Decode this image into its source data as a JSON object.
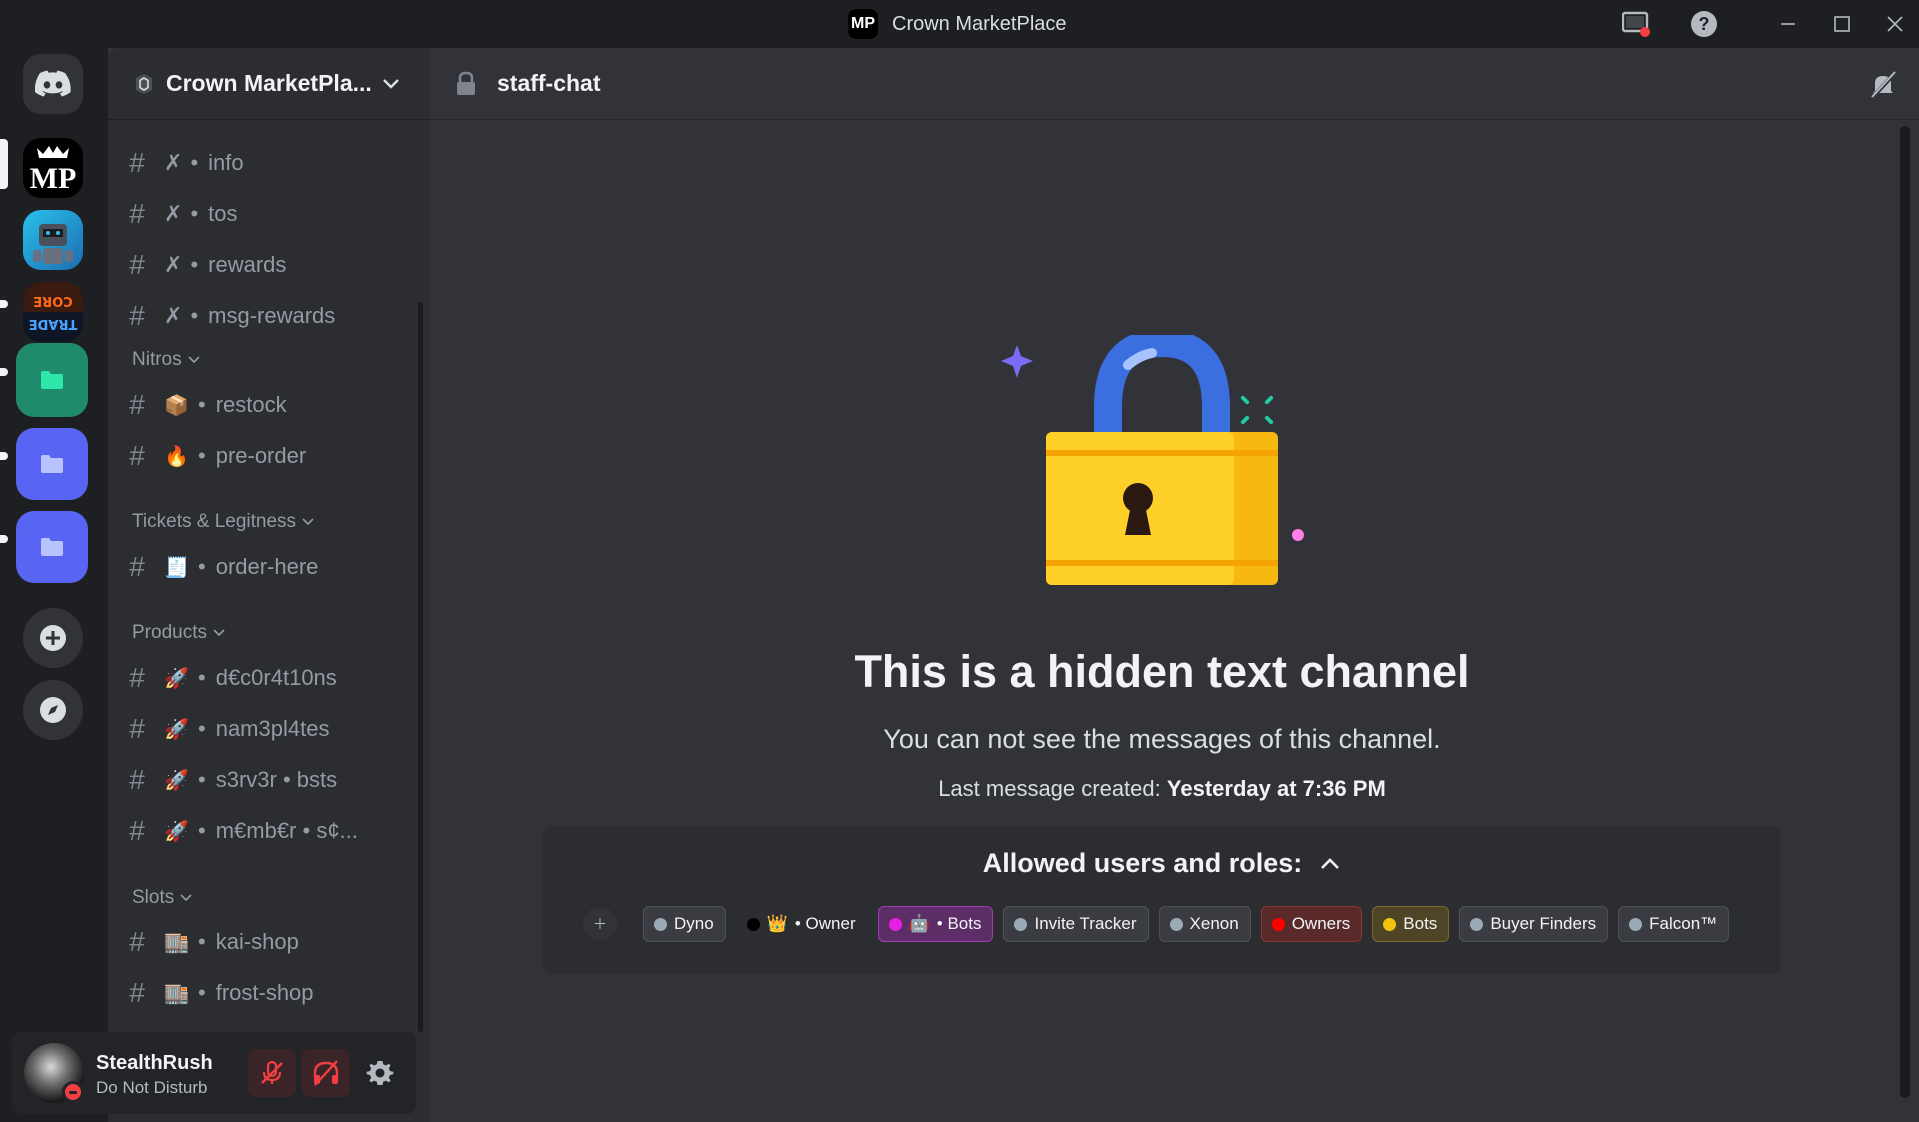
{
  "window": {
    "title": "Crown MarketPlace",
    "logo_text": "MP",
    "icons": [
      "screen-share-icon",
      "help-icon",
      "minimize-icon",
      "maximize-icon",
      "close-icon"
    ]
  },
  "servers": {
    "items": [
      {
        "name": "discord-home",
        "icon": "discord-logo-icon"
      },
      {
        "name": "crown-marketplace",
        "label": "MP"
      },
      {
        "name": "server-robot"
      },
      {
        "name": "server-trade-core"
      },
      {
        "name": "folder-green",
        "color": "#1f8b6c"
      },
      {
        "name": "folder-blue-1",
        "color": "#5865f2"
      },
      {
        "name": "folder-blue-2",
        "color": "#5865f2"
      },
      {
        "name": "add-server",
        "icon": "plus-icon"
      },
      {
        "name": "explore",
        "icon": "compass-icon"
      }
    ]
  },
  "sidebar": {
    "server_name": "Crown MarketPla...",
    "channels_top": [
      {
        "prefix": "✗",
        "label": "info"
      },
      {
        "prefix": "✗",
        "label": "tos"
      },
      {
        "prefix": "✗",
        "label": "rewards"
      },
      {
        "prefix": "✗",
        "label": "msg-rewards"
      }
    ],
    "categories": [
      {
        "name": "Nitros",
        "channels": [
          {
            "emoji": "📦",
            "label": "restock"
          },
          {
            "emoji": "🔥",
            "label": "pre-order"
          }
        ]
      },
      {
        "name": "Tickets & Legitness",
        "channels": [
          {
            "emoji": "🧾",
            "label": "order-here"
          }
        ]
      },
      {
        "name": "Products",
        "channels": [
          {
            "emoji": "🚀",
            "label": "d€c0r4t10ns"
          },
          {
            "emoji": "🚀",
            "label": "nam3pl4tes"
          },
          {
            "emoji": "🚀",
            "label": "s3rv3r • bsts"
          },
          {
            "emoji": "🚀",
            "label": "m€mb€r • s¢..."
          }
        ]
      },
      {
        "name": "Slots",
        "channels": [
          {
            "emoji": "🏬",
            "label": "kai-shop"
          },
          {
            "emoji": "🏬",
            "label": "frost-shop"
          }
        ]
      }
    ],
    "separator": "•"
  },
  "user": {
    "name": "StealthRush",
    "status": "Do Not Disturb"
  },
  "channel": {
    "name": "staff-chat"
  },
  "main": {
    "title": "This is a hidden text channel",
    "subtitle": "You can not see the messages of this channel.",
    "last_message_label": "Last message created:",
    "last_message_time": "Yesterday at 7:36 PM",
    "allowed_title": "Allowed users and roles:",
    "roles": [
      {
        "name": "Dyno",
        "color": "#99aab5"
      },
      {
        "name": "• Owner",
        "color": "#000000",
        "emoji": "👑",
        "plain": true
      },
      {
        "name": "• Bots",
        "color": "#e91ee4",
        "emoji": "🤖",
        "highlight": "#5c2d66"
      },
      {
        "name": "Invite Tracker",
        "color": "#99aab5"
      },
      {
        "name": "Xenon",
        "color": "#99aab5"
      },
      {
        "name": "Owners",
        "color": "#ff0000",
        "highlight": "#5a2a2a"
      },
      {
        "name": "Bots",
        "color": "#f1c40f",
        "highlight": "#4e4526"
      },
      {
        "name": "Buyer Finders",
        "color": "#99aab5"
      },
      {
        "name": "Falcon™",
        "color": "#99aab5"
      }
    ]
  },
  "colors": {
    "background": "#313338",
    "sidebar": "#2b2d31",
    "rail": "#1e1f22",
    "accent": "#5865f2",
    "dnd": "#f23f43"
  }
}
